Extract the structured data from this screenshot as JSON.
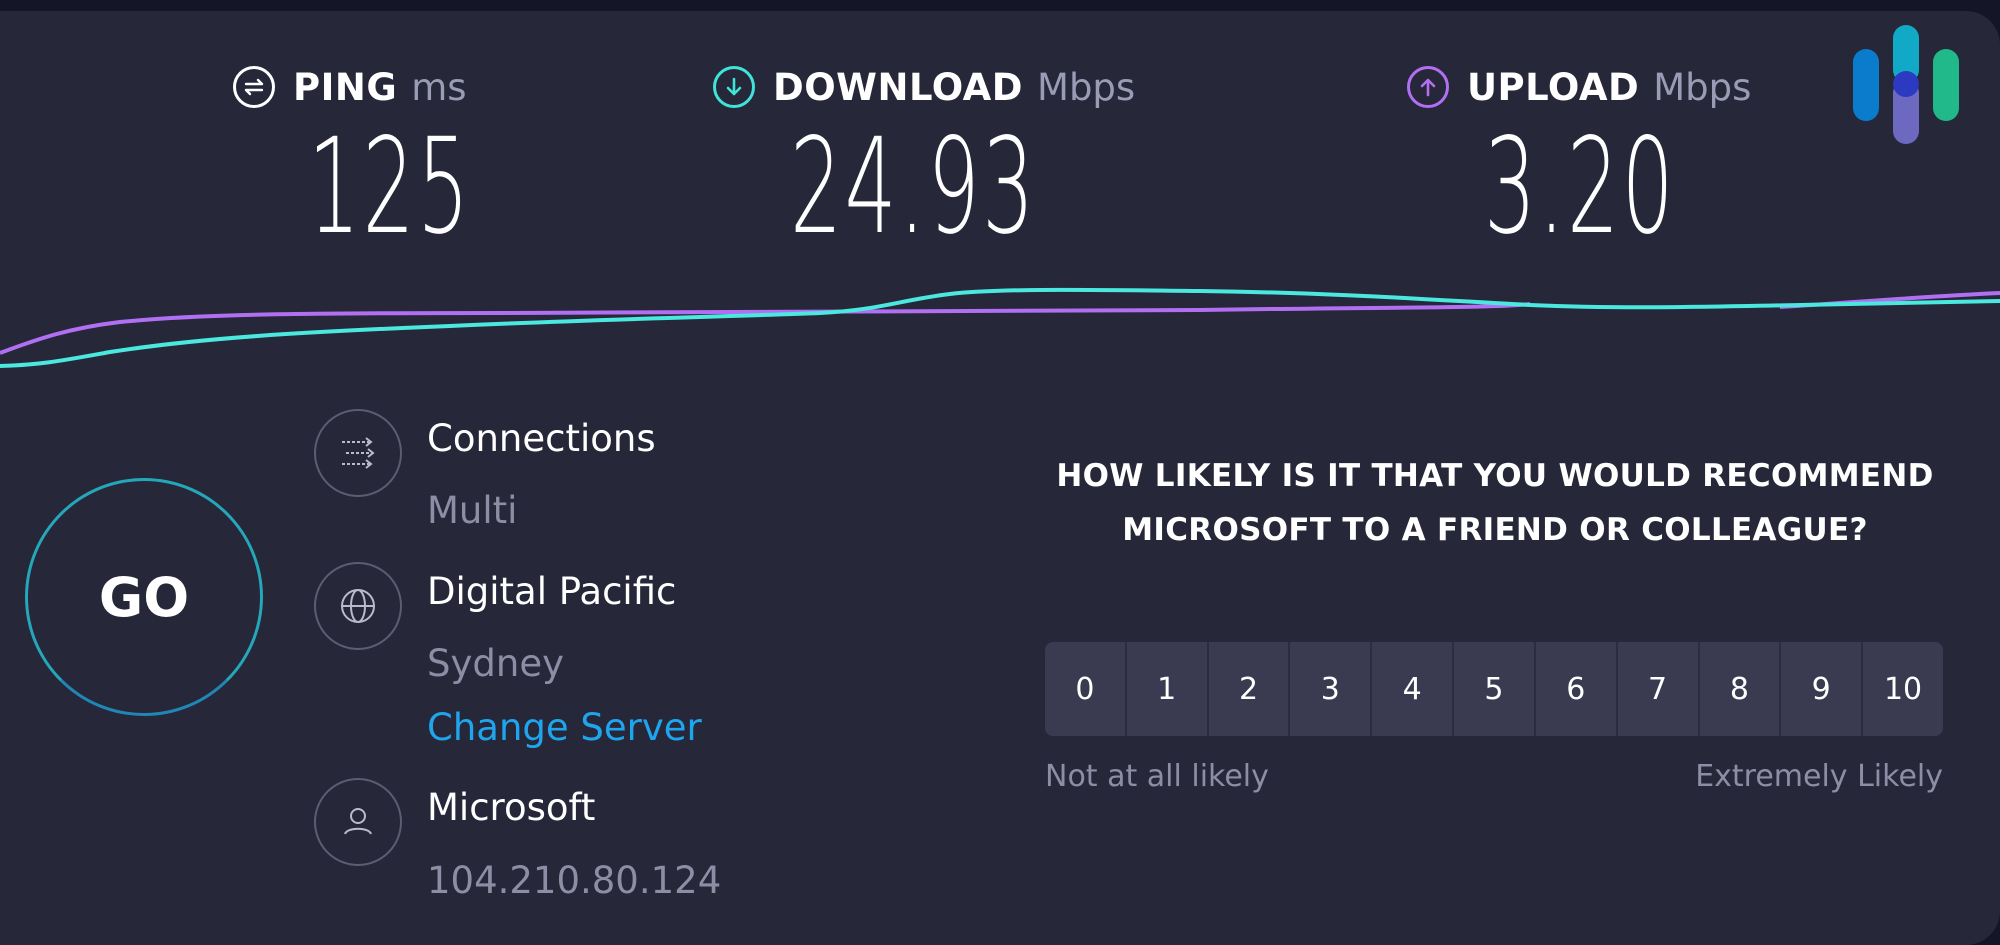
{
  "metrics": {
    "ping": {
      "icon": "ping-icon",
      "label": "PING",
      "unit": "ms",
      "value": "125",
      "color": "#ffffff"
    },
    "download": {
      "icon": "download-arrow-icon",
      "label": "DOWNLOAD",
      "unit": "Mbps",
      "value": "24.93",
      "color": "#3fe3d8"
    },
    "upload": {
      "icon": "upload-arrow-icon",
      "label": "UPLOAD",
      "unit": "Mbps",
      "value": "3.20",
      "color": "#b26ff2"
    }
  },
  "logo": {
    "icon": "speedtest-logo-icon",
    "colors": [
      "#0a7ccb",
      "#12a9c6",
      "#6d68c0",
      "#22b98a",
      "#2b3ac0"
    ]
  },
  "graph": {
    "download_color": "#4ae8de",
    "upload_color": "#b16ff2"
  },
  "go_button": {
    "label": "GO",
    "ring_color": "#24a7b9"
  },
  "connection": {
    "icon": "connections-arrows-icon",
    "title": "Connections",
    "value": "Multi"
  },
  "server": {
    "icon": "globe-icon",
    "title": "Digital Pacific",
    "location": "Sydney",
    "change_link": "Change Server",
    "link_color": "#1fa5ee"
  },
  "provider": {
    "icon": "user-icon",
    "title": "Microsoft",
    "ip": "104.210.80.124"
  },
  "survey": {
    "question": "HOW LIKELY IS IT THAT YOU WOULD RECOMMEND MICROSOFT TO A FRIEND OR COLLEAGUE?",
    "scale": [
      "0",
      "1",
      "2",
      "3",
      "4",
      "5",
      "6",
      "7",
      "8",
      "9",
      "10"
    ],
    "low_label": "Not at all likely",
    "high_label": "Extremely Likely"
  }
}
